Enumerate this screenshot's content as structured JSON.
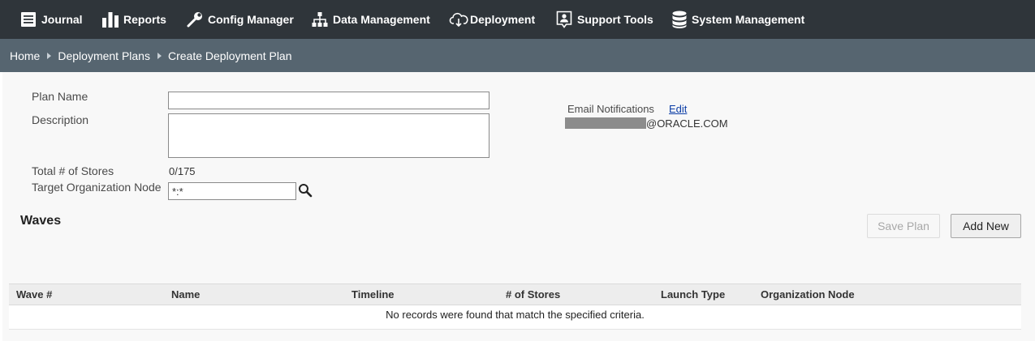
{
  "nav": {
    "items": [
      {
        "label": "Journal",
        "icon": "book-icon"
      },
      {
        "label": "Reports",
        "icon": "bar-chart-icon"
      },
      {
        "label": "Config Manager",
        "icon": "wrench-icon"
      },
      {
        "label": "Data Management",
        "icon": "hierarchy-icon"
      },
      {
        "label": "Deployment",
        "icon": "cloud-download-icon"
      },
      {
        "label": "Support Tools",
        "icon": "support-agent-icon"
      },
      {
        "label": "System Management",
        "icon": "database-icon"
      }
    ]
  },
  "breadcrumb": [
    "Home",
    "Deployment Plans",
    "Create Deployment Plan"
  ],
  "form": {
    "plan_name_label": "Plan Name",
    "plan_name_value": "",
    "description_label": "Description",
    "description_value": "",
    "total_stores_label": "Total # of Stores",
    "total_stores_value": "0/175",
    "target_org_label": "Target Organization Node",
    "target_org_value": "*:*"
  },
  "email": {
    "label": "Email Notifications",
    "edit_label": "Edit",
    "address_suffix": "@ORACLE.COM"
  },
  "waves": {
    "title": "Waves",
    "save_plan_label": "Save Plan",
    "add_new_label": "Add New",
    "columns": [
      "Wave #",
      "Name",
      "Timeline",
      "# of Stores",
      "Launch Type",
      "Organization Node"
    ],
    "empty_message": "No records were found that match the specified criteria."
  },
  "colors": {
    "nav_bg": "#2f353a",
    "breadcrumb_bg": "#566570",
    "link": "#0b3da6"
  }
}
